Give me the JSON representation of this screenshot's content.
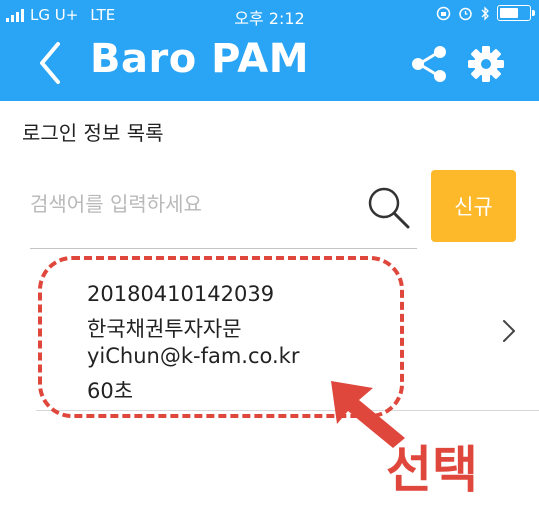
{
  "status_bar": {
    "carrier": "LG U+",
    "network": "LTE",
    "time": "오후 2:12"
  },
  "header": {
    "title": "Baro PAM",
    "back_icon": "chevron-left-icon",
    "share_icon": "share-icon",
    "settings_icon": "gear-icon",
    "background_color": "#2aa4f4"
  },
  "main": {
    "section_title": "로그인 정보 목록",
    "search": {
      "placeholder": "검색어를 입력하세요",
      "value": ""
    },
    "new_button_label": "신규",
    "new_button_color": "#fdb92a",
    "items": [
      {
        "id": "20180410142039",
        "name": "한국채권투자자문",
        "email": "yiChun@k-fam.co.kr",
        "duration": "60초"
      }
    ]
  },
  "annotation": {
    "label": "선택",
    "color": "#e0473c"
  }
}
